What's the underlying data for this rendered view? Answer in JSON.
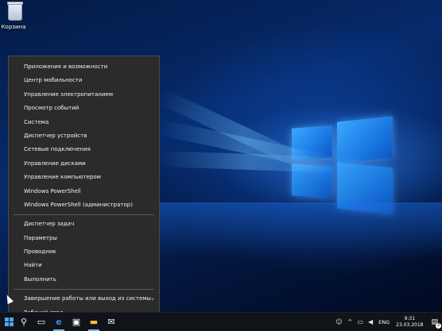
{
  "desktop": {
    "recycle_bin": {
      "label": "Корзина",
      "icon": "recycle-bin-icon"
    }
  },
  "winx_menu": {
    "group1": [
      "Приложения и возможности",
      "Центр мобильности",
      "Управление электропитанием",
      "Просмотр событий",
      "Система",
      "Диспетчер устройств",
      "Сетевые подключения",
      "Управление дисками",
      "Управление компьютером",
      "Windows PowerShell",
      "Windows PowerShell (администратор)"
    ],
    "group2": [
      "Диспетчер задач",
      "Параметры",
      "Проводник",
      "Найти",
      "Выполнить"
    ],
    "group3": [
      {
        "label": "Завершение работы или выход из системы",
        "submenu": "›"
      },
      {
        "label": "Рабочий стол"
      }
    ]
  },
  "taskbar": {
    "icons": [
      "start-icon",
      "search-icon",
      "task-view-icon",
      "edge-icon",
      "store-icon",
      "file-explorer-icon",
      "mail-icon"
    ],
    "tray": {
      "language": "ENG",
      "time": "9:31",
      "date": "23.03.2018",
      "notifications_badge": "3"
    }
  },
  "colors": {
    "accent": "#76b9ed",
    "menu_bg": "#2b2b2b",
    "taskbar_bg": "#101318"
  }
}
